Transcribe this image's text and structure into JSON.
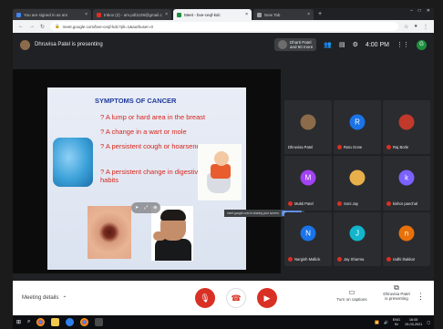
{
  "browser": {
    "tabs": [
      {
        "label": "You are signed in as am",
        "color": "#4285f4",
        "active": false
      },
      {
        "label": "Inbox (2) - am.pdl1108@gmail.c",
        "color": "#d93025",
        "active": false
      },
      {
        "label": "Meet - bve-ceqf-kdc",
        "color": "#1e8e3e",
        "active": true
      },
      {
        "label": "New Tab",
        "color": "#9aa0a6",
        "active": false
      }
    ],
    "url": "meet.google.com/bve-ceqf-kdc?pli=1&authuser=0",
    "window_controls": [
      "–",
      "□",
      "✕"
    ]
  },
  "meet_top": {
    "presenting_text": "Dhruvisa Patel is presenting",
    "chip_line1": "Dharti Patel",
    "chip_line2": "and 60 more",
    "clock": "4:00 PM",
    "self_initial": "G"
  },
  "slide": {
    "title": "SYMPTOMS OF CANCER",
    "bullets": [
      "? A lump or hard area in the breast",
      "? A change in a wart or mole",
      "? A persistent cough or hoarseness",
      "? A persistent change in digestive and bowel habits"
    ]
  },
  "tooltip": {
    "text": "meet.google.com is sharing your screen.",
    "stop": "Stop sharing"
  },
  "participants": [
    {
      "name": "Dhruvisa Patel",
      "initial": "",
      "color": "#8b6b4a",
      "photo": true
    },
    {
      "name": "Rutu Gone",
      "initial": "R",
      "color": "#1a73e8",
      "photo": false
    },
    {
      "name": "Raj Borle",
      "initial": "",
      "color": "#c0392b",
      "photo": true
    },
    {
      "name": "Mukti Patel",
      "initial": "M",
      "color": "#a142f4",
      "photo": false
    },
    {
      "name": "Soni Jay",
      "initial": "",
      "color": "#e8b04a",
      "photo": true
    },
    {
      "name": "kishor panchal",
      "initial": "k",
      "color": "#7b61ff",
      "photo": false
    },
    {
      "name": "Nargish Mallick",
      "initial": "N",
      "color": "#1a73e8",
      "photo": false
    },
    {
      "name": "Jay Sharma",
      "initial": "J",
      "color": "#12b5cb",
      "photo": false
    },
    {
      "name": "radhi thakkar",
      "initial": "n",
      "color": "#e8710a",
      "photo": false
    }
  ],
  "bottom": {
    "meeting_details": "Meeting details",
    "captions": "Turn on captions",
    "present_line1": "Dhruvisa Patel",
    "present_line2": "is presenting"
  },
  "taskbar": {
    "lang": "ENG",
    "region": "IN",
    "time": "16:00",
    "date": "19-03-2021"
  }
}
